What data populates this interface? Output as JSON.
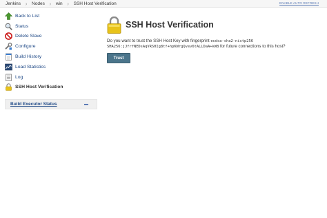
{
  "breadcrumbs": [
    "Jenkins",
    "Nodes",
    "win",
    "SSH Host Verification"
  ],
  "auto_refresh": "ENABLE AUTO REFRESH",
  "side_panel": {
    "tasks": [
      {
        "label": "Back to List",
        "icon": "up-arrow-icon"
      },
      {
        "label": "Status",
        "icon": "search-icon"
      },
      {
        "label": "Delete Slave",
        "icon": "no-entry-icon"
      },
      {
        "label": "Configure",
        "icon": "wrench-icon"
      },
      {
        "label": "Build History",
        "icon": "notepad-icon"
      },
      {
        "label": "Load Statistics",
        "icon": "chart-icon"
      },
      {
        "label": "Log",
        "icon": "clipboard-icon"
      },
      {
        "label": "SSH Host Verification",
        "icon": "lock-icon"
      }
    ]
  },
  "executor": {
    "title": "Build Executor Status"
  },
  "main": {
    "title": "SSH Host Verification",
    "question_prefix": "Do you want to trust the SSH Host Key with fingerprint",
    "key_type": "ecdsa-sha2-nistp256",
    "fingerprint": "SHA256:jJfrfNEDsAqVRS0Ig8tf+hpKWrgQvev6tALLDaA+kW8",
    "question_suffix": "for future connections to this host?",
    "trust_label": "Trust"
  },
  "colors": {
    "link": "#204a87",
    "button": "#4b758b",
    "lock": "#e8c31a"
  }
}
